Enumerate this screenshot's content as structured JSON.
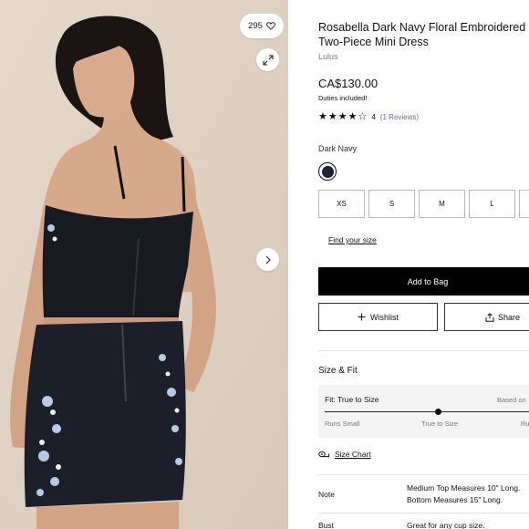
{
  "gallery": {
    "like_count": "295",
    "icons": {
      "like": "heart-icon",
      "expand": "expand-icon",
      "next": "chevron-right-icon"
    }
  },
  "product": {
    "title": "Rosabella Dark Navy Floral Embroidered Two-Piece Mini Dress",
    "brand": "Lulus",
    "price": "CA$130.00",
    "duties_note": "Duties included!",
    "rating": {
      "stars_filled": 4,
      "stars_total": 5,
      "value": "4",
      "reviews_label": "(1 Reviews)"
    },
    "color": {
      "label": "Dark Navy",
      "swatch_hex": "#1d2436"
    },
    "sizes": [
      "XS",
      "S",
      "M",
      "L",
      ""
    ],
    "find_size_label": "Find your size",
    "add_to_bag_label": "Add to Bag",
    "wishlist_label": "Wishlist",
    "share_label": "Share"
  },
  "size_fit": {
    "title": "Size & Fit",
    "fit_label": "Fit: True to Size",
    "based_on": "Based on",
    "scale": {
      "left": "Runs Small",
      "middle": "True to Size",
      "right": "Ru"
    },
    "fit_value": 0.5,
    "size_chart_label": "Size Chart"
  },
  "specs": [
    {
      "key": "Note",
      "value_lines": [
        "Medium Top Measures 10\" Long.",
        "Bottom Measures 15\" Long."
      ]
    },
    {
      "key": "Bust",
      "value_lines": [
        "Great for any cup size."
      ]
    }
  ]
}
